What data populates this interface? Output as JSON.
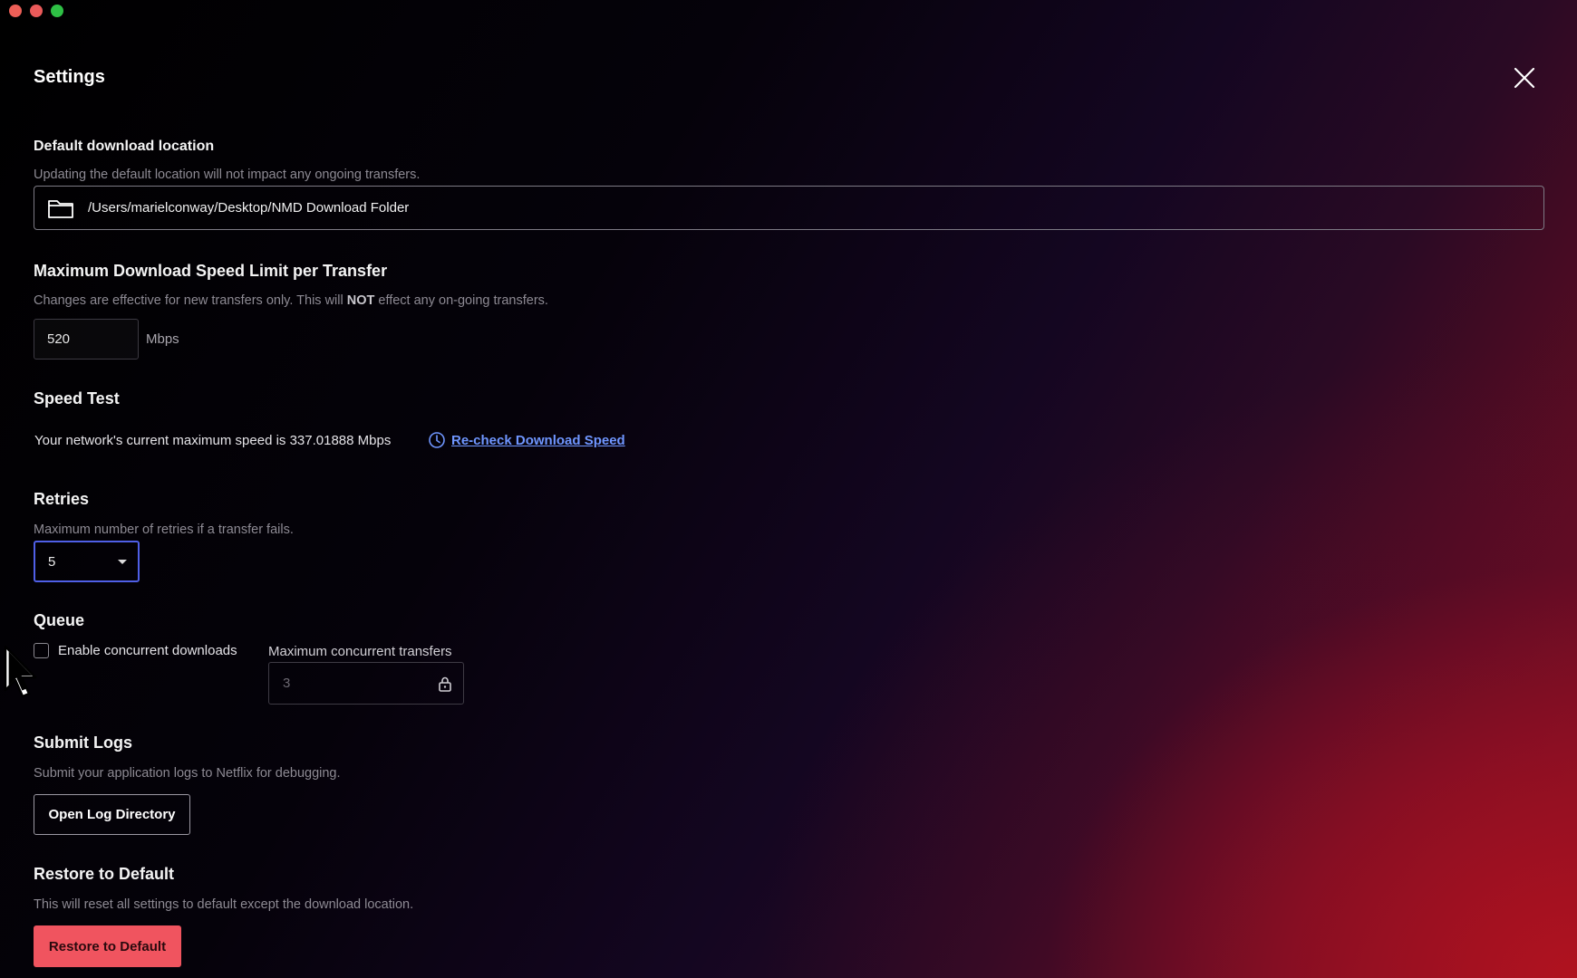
{
  "window": {
    "title": "Settings"
  },
  "download_location": {
    "title": "Default download location",
    "description": "Updating the default location will not impact any ongoing transfers.",
    "path": "/Users/marielconway/Desktop/NMD Download Folder",
    "icon": "folder-icon"
  },
  "speed_limit": {
    "title": "Maximum Download Speed Limit per Transfer",
    "description_before": "Changes are effective for new transfers only. This will ",
    "description_bold": "NOT",
    "description_after": " effect any on-going transfers.",
    "value": "520",
    "unit": "Mbps"
  },
  "speed_test": {
    "title": "Speed Test",
    "text": "Your network's current maximum speed is 337.01888 Mbps",
    "link_label": "Re-check Download Speed",
    "link_color": "#6f96ff"
  },
  "retries": {
    "title": "Retries",
    "description": "Maximum number of retries if a transfer fails.",
    "selected": "5",
    "focus_color": "#4f5fe6"
  },
  "queue": {
    "title": "Queue",
    "checkbox_label": "Enable concurrent downloads",
    "checked": false,
    "max_label": "Maximum concurrent transfers",
    "max_value": "3"
  },
  "logs": {
    "title": "Submit Logs",
    "description": "Submit your application logs to Netflix for debugging.",
    "button_label": "Open Log Directory"
  },
  "restore": {
    "title": "Restore to Default",
    "description": "This will reset all settings to default except the download location.",
    "button_label": "Restore to Default",
    "button_color": "#f0545f"
  }
}
